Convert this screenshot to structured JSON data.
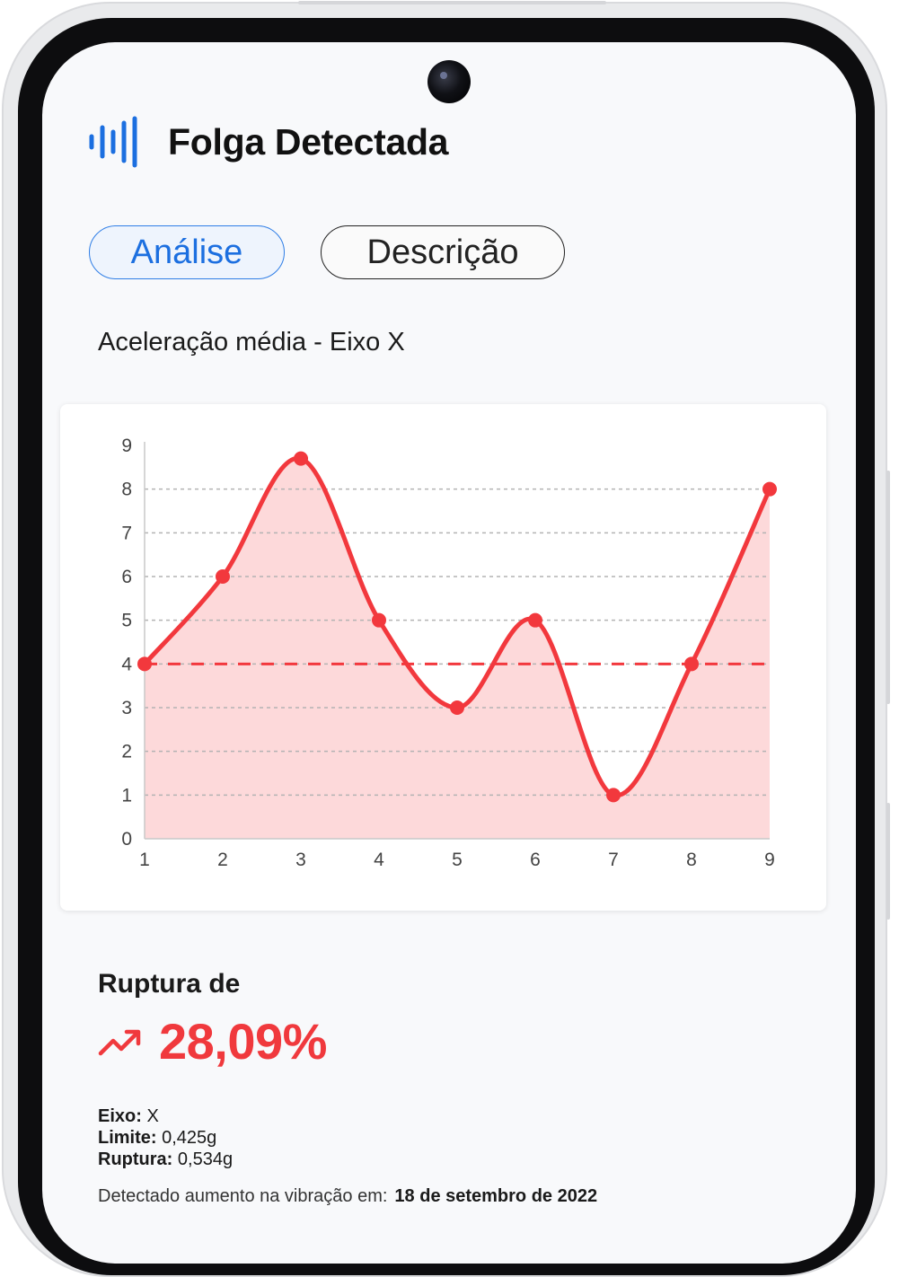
{
  "header": {
    "title": "Folga Detectada",
    "icon": "waveform-icon",
    "icon_color": "#1c6fe0"
  },
  "tabs": [
    {
      "label": "Análise",
      "active": true
    },
    {
      "label": "Descrição",
      "active": false
    }
  ],
  "chart_title": "Aceleração média - Eixo X",
  "chart_data": {
    "type": "area",
    "x": [
      1,
      2,
      3,
      4,
      5,
      6,
      7,
      8,
      9
    ],
    "series": [
      {
        "values": [
          4,
          6,
          8.7,
          5,
          3,
          5,
          1,
          4,
          8
        ],
        "color": "#f2383d",
        "fill": "#fdd9da"
      }
    ],
    "threshold": 4,
    "xlim": [
      1,
      9
    ],
    "ylim": [
      0,
      9
    ],
    "y_ticks": [
      0,
      1,
      2,
      3,
      4,
      5,
      6,
      7,
      8,
      9
    ],
    "x_ticks": [
      1,
      2,
      3,
      4,
      5,
      6,
      7,
      8,
      9
    ],
    "grid": true,
    "xlabel": "",
    "ylabel": ""
  },
  "summary": {
    "title": "Ruptura de",
    "percent": "28,09%",
    "trend_icon": "trending-up-icon",
    "accent": "#f0393d"
  },
  "details": {
    "axis_label": "Eixo:",
    "axis_value": "X",
    "limit_label": "Limite:",
    "limit_value": "0,425g",
    "rupture_label": "Ruptura:",
    "rupture_value": "0,534g"
  },
  "detected": {
    "label": "Detectado aumento na vibração em:",
    "date": "18 de setembro de 2022"
  }
}
